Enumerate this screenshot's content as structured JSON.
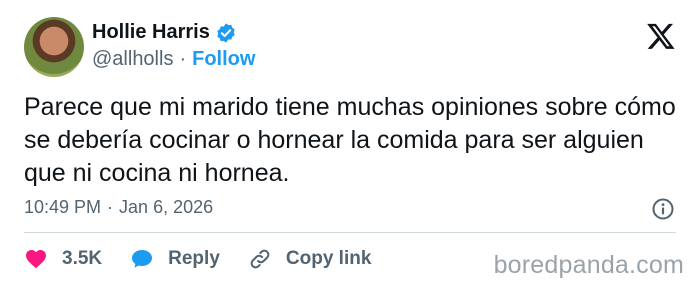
{
  "author": {
    "name": "Hollie Harris",
    "handle": "@allholls",
    "separator": "·",
    "follow_label": "Follow"
  },
  "tweet": {
    "text": "Parece que mi marido tiene muchas opiniones sobre cómo se debería cocinar o hornear la comida para ser alguien que ni cocina ni hornea.",
    "time": "10:49 PM",
    "separator": "·",
    "date": "Jan 6, 2026"
  },
  "actions": {
    "likes": "3.5K",
    "reply_label": "Reply",
    "copy_label": "Copy link"
  },
  "watermark": "boredpanda.com",
  "icons": {
    "verified": "verified-badge-icon",
    "x_logo": "x-logo-icon",
    "info": "info-icon",
    "like": "heart-icon",
    "reply": "speech-bubble-icon",
    "copy": "link-icon"
  },
  "colors": {
    "accent": "#1d9bf0",
    "like": "#f91880",
    "muted": "#536471",
    "text": "#0f1419"
  }
}
